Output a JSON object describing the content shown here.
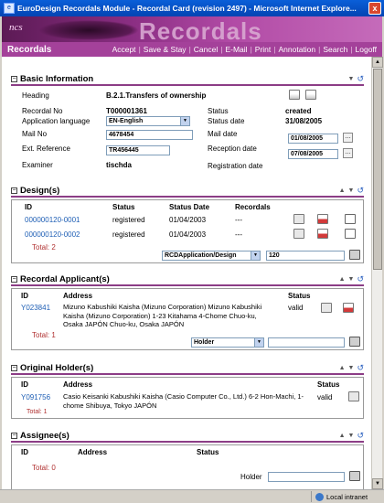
{
  "window": {
    "title": "EuroDesign Recordals Module - Recordal Card (revision 2497) - Microsoft Internet Explore...",
    "close": "x"
  },
  "banner": {
    "logo": "ncs",
    "watermark": "Recordals"
  },
  "navbar": {
    "brand": "Recordals",
    "links": [
      "Accept",
      "Save & Stay",
      "Cancel",
      "E-Mail",
      "Print",
      "Annotation",
      "Search",
      "Logoff"
    ]
  },
  "basic": {
    "title": "Basic Information",
    "heading_label": "Heading",
    "heading_value": "B.2.1.Transfers of ownership",
    "recordal_no_label": "Recordal No",
    "recordal_no": "T000001361",
    "status_label": "Status",
    "status": "created",
    "app_lang_label": "Application language",
    "app_lang": "EN-English",
    "status_date_label": "Status date",
    "status_date": "31/08/2005",
    "mail_no_label": "Mail No",
    "mail_no": "4678454",
    "mail_date_label": "Mail date",
    "mail_date": "01/08/2005",
    "ext_ref_label": "Ext. Reference",
    "ext_ref": "TR456445",
    "reception_date_label": "Reception date",
    "reception_date": "07/08/2005",
    "examiner_label": "Examiner",
    "examiner": "tischda",
    "reg_date_label": "Registration date"
  },
  "designs": {
    "title": "Design(s)",
    "columns": [
      "ID",
      "Status",
      "Status Date",
      "Recordals"
    ],
    "rows": [
      {
        "id": "000000120-0001",
        "status": "registered",
        "date": "01/04/2003",
        "recordals": "---"
      },
      {
        "id": "000000120-0002",
        "status": "registered",
        "date": "01/04/2003",
        "recordals": "---"
      }
    ],
    "total": "Total: 2",
    "filter_select": "RCDApplication/Design",
    "filter_value": "120"
  },
  "applicants": {
    "title": "Recordal Applicant(s)",
    "columns": [
      "ID",
      "Address",
      "Status"
    ],
    "rows": [
      {
        "id": "Y023841",
        "address": "Mizuno Kabushiki Kaisha (Mizuno Corporation) Mizuno Kabushiki Kaisha (Mizuno Corporation) 1-23 Kitahama 4-Chome Chuo-ku, Osaka JAPÓN Chuo-ku, Osaka JAPÓN",
        "status": "valid"
      }
    ],
    "total": "Total: 1",
    "filter_select": "Holder",
    "filter_value": ""
  },
  "holders": {
    "title": "Original Holder(s)",
    "columns": [
      "ID",
      "Address",
      "Status"
    ],
    "rows": [
      {
        "id": "Y091756",
        "address": "Casio Keisanki Kabushiki Kaisha (Casio Computer Co., Ltd.) 6-2 Hon-Machi, 1-chome Shibuya, Tokyo JAPÓN",
        "status": "valid"
      }
    ],
    "total": "Total: 1"
  },
  "assignee": {
    "title": "Assignee(s)",
    "columns": [
      "ID",
      "Address",
      "Status"
    ],
    "total": "Total: 0",
    "filter_label": "Holder",
    "filter_value": ""
  },
  "status_bar": {
    "zone": "Local intranet"
  },
  "colors": {
    "accent": "#a4419a",
    "title_blue": "#0a5fd8",
    "link": "#1f5fb5",
    "total": "#b03030"
  }
}
